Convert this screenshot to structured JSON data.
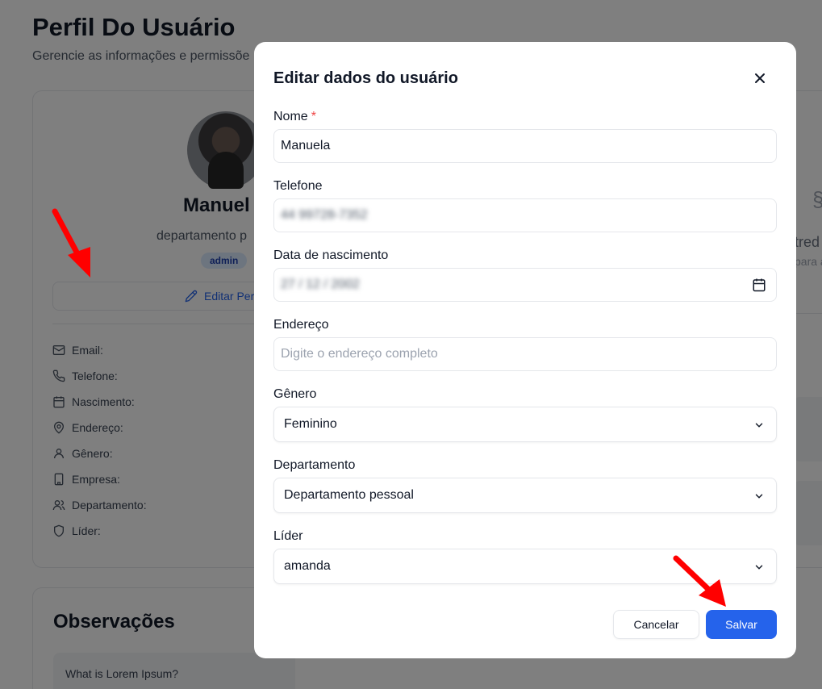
{
  "page": {
    "title": "Perfil Do Usuário",
    "subtitle": "Gerencie as informações e permissõe"
  },
  "profile": {
    "name": "Manuel",
    "department": "departamento p",
    "role_badge": "admin",
    "edit_button": "Editar Per",
    "info_labels": [
      "Email:",
      "Telefone:",
      "Nascimento:",
      "Endereço:",
      "Gênero:",
      "Empresa:",
      "Departamento:",
      "Líder:"
    ]
  },
  "notes": {
    "title": "Observações",
    "first_item": "What is Lorem Ipsum?"
  },
  "right_panel": {
    "text1": "tred",
    "text2": "para a"
  },
  "modal": {
    "title": "Editar dados do usuário",
    "close_icon": "close-icon",
    "fields": {
      "name": {
        "label": "Nome",
        "required_mark": "*",
        "value": "Manuela"
      },
      "phone": {
        "label": "Telefone",
        "value": "44 99728-7352"
      },
      "birth": {
        "label": "Data de nascimento",
        "value": "27 / 12 / 2002",
        "icon": "calendar-icon"
      },
      "address": {
        "label": "Endereço",
        "placeholder": "Digite o endereço completo"
      },
      "gender": {
        "label": "Gênero",
        "value": "Feminino"
      },
      "department": {
        "label": "Departamento",
        "value": "Departamento pessoal"
      },
      "leader": {
        "label": "Líder",
        "value": "amanda"
      }
    },
    "cancel_label": "Cancelar",
    "save_label": "Salvar"
  },
  "colors": {
    "primary": "#2563eb",
    "required": "#ef4444",
    "annotation_arrow": "#ff0000",
    "overlay": "rgba(0,0,0,0.5)"
  }
}
